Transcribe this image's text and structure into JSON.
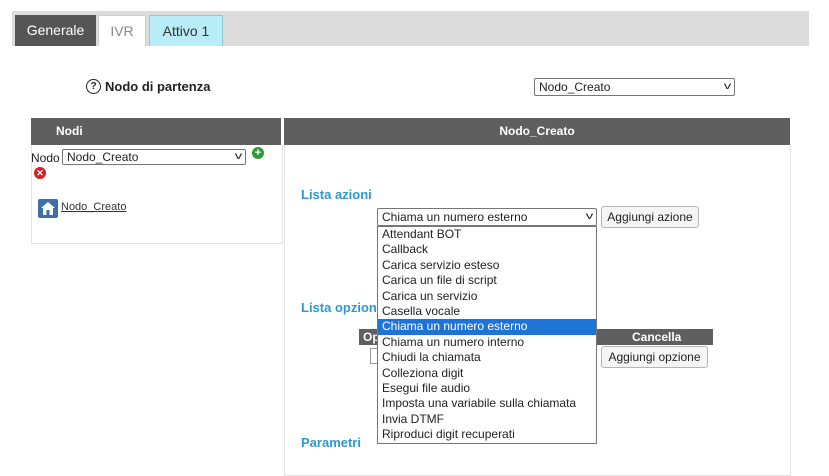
{
  "tabs": {
    "generale": "Generale",
    "ivr": "IVR",
    "attivo": "Attivo 1"
  },
  "start": {
    "label": "Nodo di partenza",
    "value": "Nodo_Creato"
  },
  "left_panel": {
    "header": "Nodi",
    "nodo_label": "Nodo",
    "nodo_value": "Nodo_Creato",
    "node_link": "Nodo_Creato"
  },
  "right_panel": {
    "header": "Nodo_Creato",
    "lista_azioni": "Lista azioni",
    "action_value": "Chiama un numero esterno",
    "aggiungi_azione": "Aggiungi azione",
    "lista_opzioni": "Lista opzioni",
    "col_op": "Op",
    "col_cancella": "Cancella",
    "aggiungi_opzione": "Aggiungi opzione",
    "parametri": "Parametri"
  },
  "dropdown_options": [
    "Attendant BOT",
    "Callback",
    "Carica servizio esteso",
    "Carica un file di script",
    "Carica un servizio",
    "Casella vocale",
    "Chiama un numero esterno",
    "Chiama un numero interno",
    "Chiudi la chiamata",
    "Colleziona digit",
    "Esegui file audio",
    "Imposta una variabile sulla chiamata",
    "Invia DTMF",
    "Riproduci digit recuperati"
  ],
  "selected_option_index": 6,
  "colors": {
    "accent": "#2c9ad0",
    "header": "#5f5f5f",
    "tab_active": "#555555",
    "tab_attivo": "#b8ecf6",
    "selected": "#1e74d6"
  }
}
